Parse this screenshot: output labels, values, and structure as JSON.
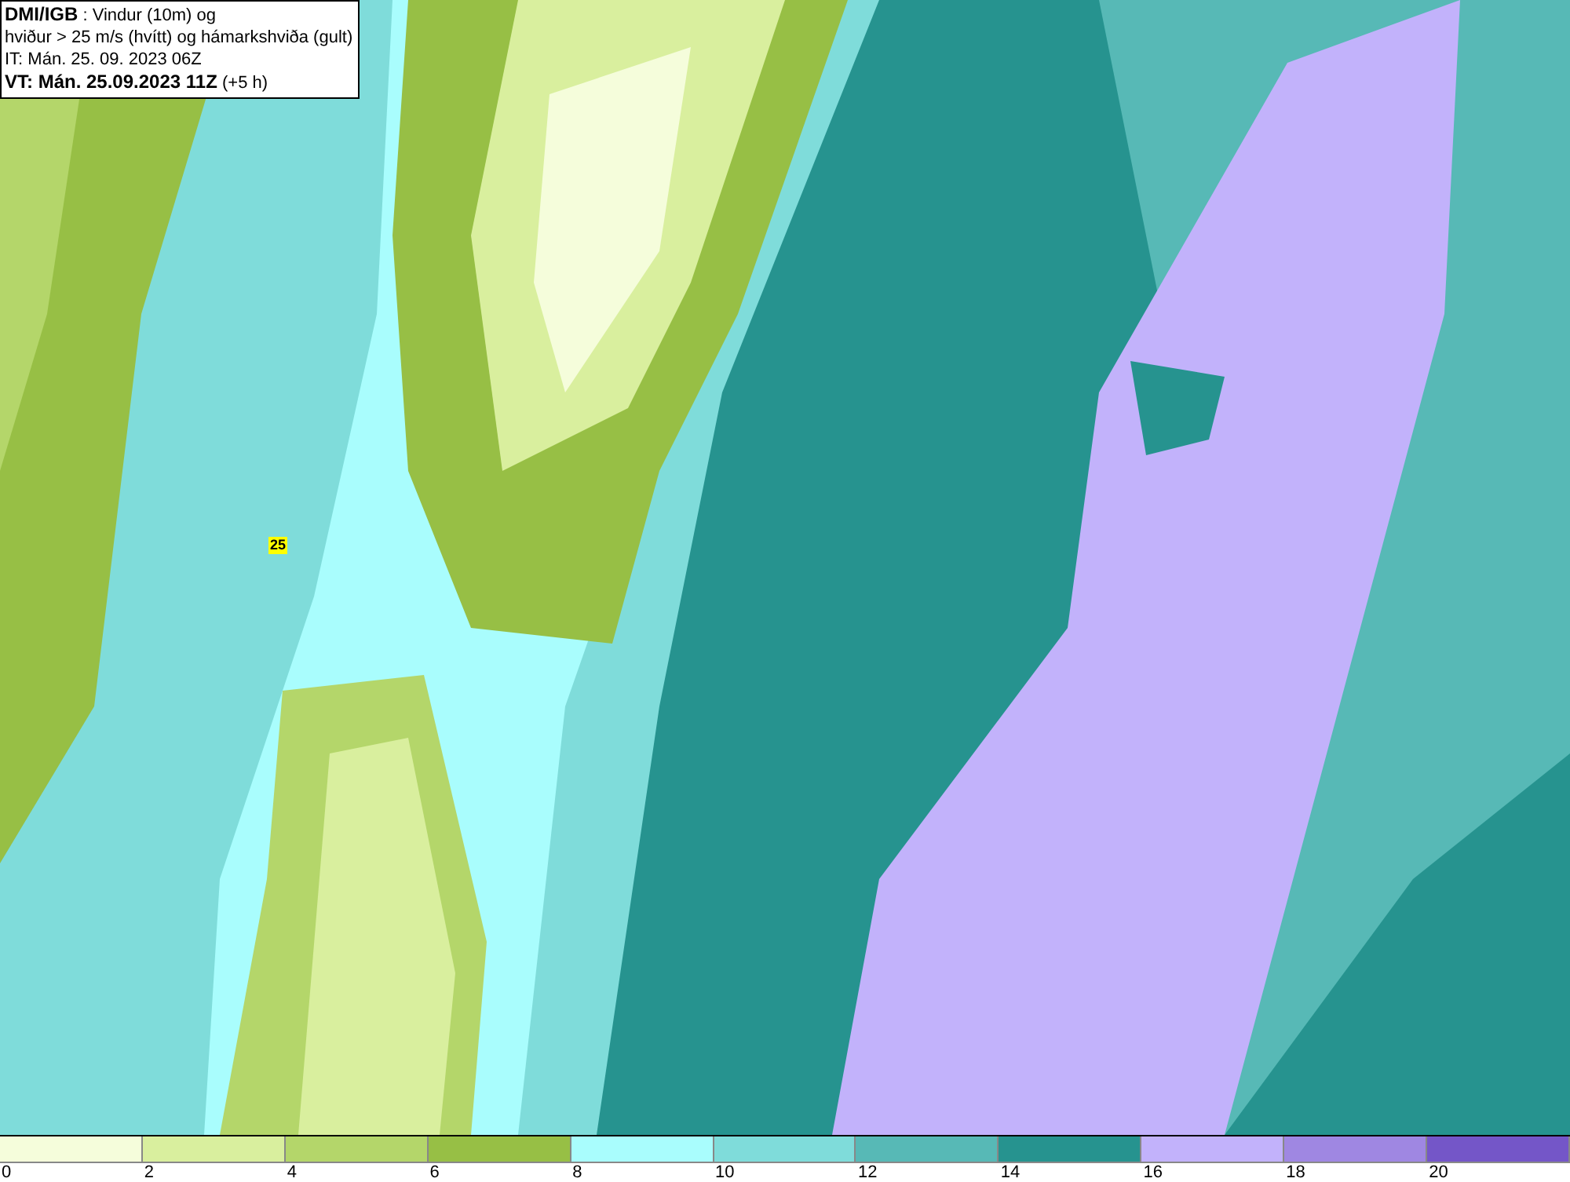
{
  "info_box": {
    "lines": [
      "**DMI/IGB** : Vindur (10m) og",
      "hviður > 25 m/s (hvítt) og hámarkshviða (gult)",
      "IT: Mán. 25. 09. 2023 06Z",
      "**VT: Mán. 25.09.2023 11Z** (+5 h)"
    ]
  },
  "gust_label": "25",
  "legend": {
    "bins": [
      {
        "color": "#f5fddb"
      },
      {
        "color": "#d9ef9e"
      },
      {
        "color": "#b4d66a"
      },
      {
        "color": "#97bf45"
      },
      {
        "color": "#a9fdfd"
      },
      {
        "color": "#7fdcda"
      },
      {
        "color": "#57b9b6"
      },
      {
        "color": "#26938f"
      },
      {
        "color": "#c2b2fb"
      },
      {
        "color": "#9f87e2"
      },
      {
        "color": "#7456c8"
      }
    ],
    "ticks": [
      "0",
      "2",
      "4",
      "6",
      "8",
      "10",
      "12",
      "14",
      "16",
      "18",
      "20"
    ]
  }
}
